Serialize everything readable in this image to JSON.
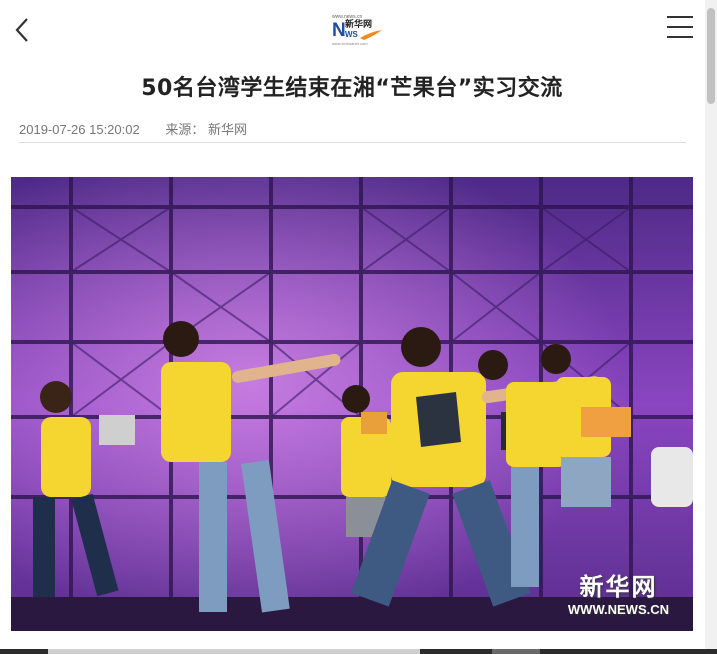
{
  "header": {
    "back_icon": "chevron-left-icon",
    "logo_url_text": "www.news.cn",
    "logo_name": "新华网",
    "logo_letters": "NEWS",
    "logo_sub": "www.xinhuanet.com",
    "menu_icon": "hamburger-menu-icon"
  },
  "article": {
    "title": "50名台湾学生结束在湘“芒果台”实习交流",
    "datetime": "2019-07-26 15:20:02",
    "source": "来源：  新华网"
  },
  "photo": {
    "watermark_cn": "新华网",
    "watermark_url": "WWW.NEWS.CN"
  },
  "colors": {
    "logo_blue": "#1e4fa0",
    "logo_orange": "#f08a1c",
    "stage_purple": "#7a3fb0",
    "shirt_yellow": "#f5d630"
  }
}
